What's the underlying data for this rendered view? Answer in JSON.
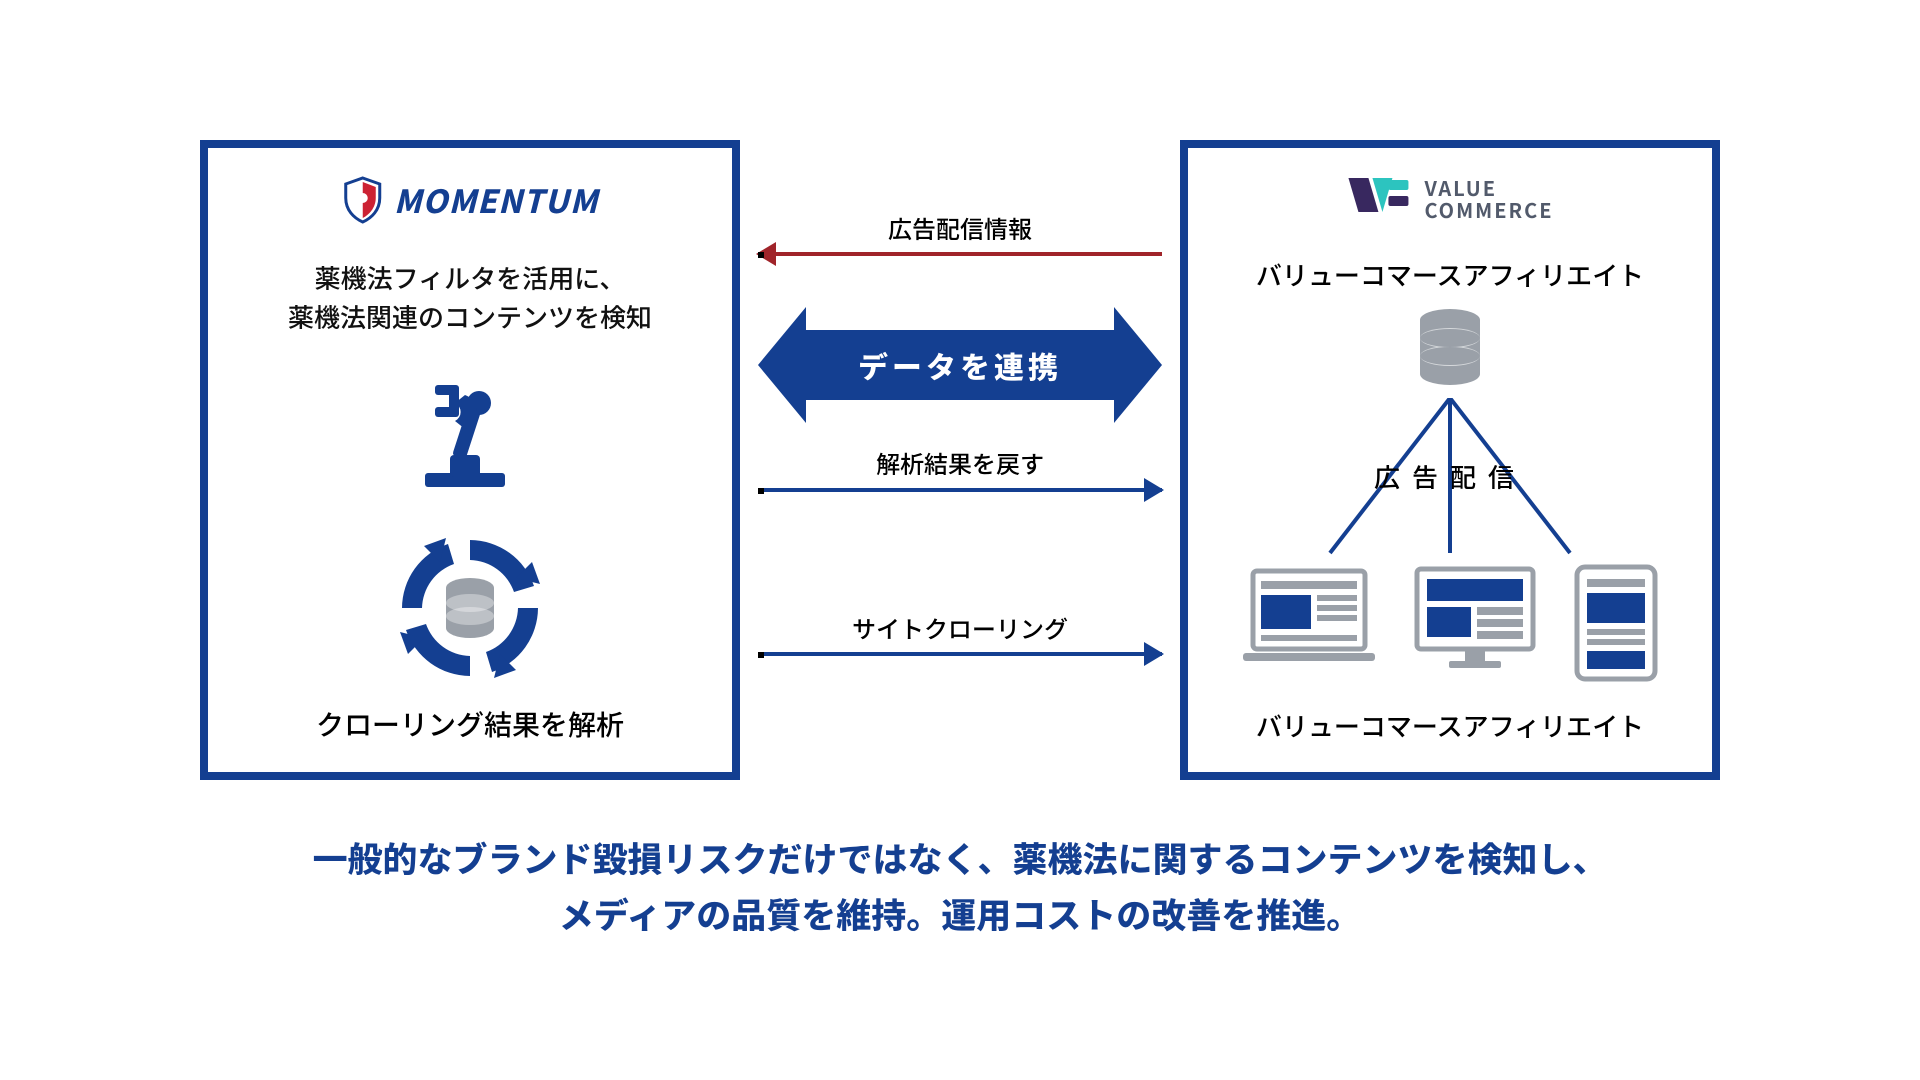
{
  "colors": {
    "brand_blue": "#143f91",
    "accent_red": "#a0242a",
    "vc_teal": "#2cc4bf",
    "vc_purple": "#38285f",
    "gray": "#9aa0a8"
  },
  "left": {
    "brand": "MOMENTUM",
    "desc_line1": "薬機法フィルタを活用に、",
    "desc_line2": "薬機法関連のコンテンツを検知",
    "caption": "クローリング結果を解析"
  },
  "right": {
    "brand_line1": "VALUE",
    "brand_line2": "COMMERCE",
    "title_top": "バリューコマースアフィリエイト",
    "fan_label": "広告配信",
    "title_bottom": "バリューコマースアフィリエイト"
  },
  "middle": {
    "ad_info": "広告配信情報",
    "data_link": "データを連携",
    "return_results": "解析結果を戻す",
    "site_crawling": "サイトクローリング"
  },
  "footer": {
    "line1": "一般的なブランド毀損リスクだけではなく、薬機法に関するコンテンツを検知し、",
    "line2": "メディアの品質を維持。運用コストの改善を推進。"
  },
  "icons": {
    "shield": "shield-icon",
    "robot_arm": "robot-arm-icon",
    "cycle_db": "cycle-db-icon",
    "database": "database-icon",
    "laptop": "laptop-icon",
    "desktop": "desktop-icon",
    "phone": "phone-icon"
  }
}
